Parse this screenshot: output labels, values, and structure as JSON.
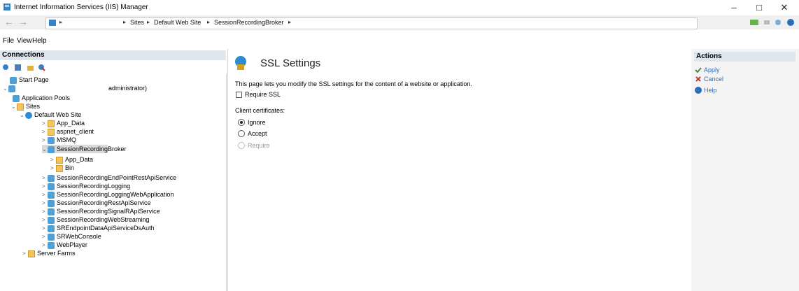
{
  "window": {
    "title": "Internet Information Services (IIS) Manager",
    "minimize": "–",
    "maximize": "□",
    "close": "✕"
  },
  "address": {
    "crumbs": [
      "Sites",
      "Default Web Site",
      "SessionRecordingBroker"
    ],
    "separator": "▸"
  },
  "menu": [
    "File",
    "View",
    "Help"
  ],
  "connections": {
    "header": "Connections",
    "tree": [
      {
        "label": "Start Page",
        "icon": "start-page-icon"
      },
      {
        "label": "administrator)",
        "icon": "server-icon",
        "expander": "⌄"
      },
      {
        "label": "Application Pools",
        "icon": "app-pools-icon"
      },
      {
        "label": "Sites",
        "icon": "sites-icon",
        "expander": "⌄"
      },
      {
        "label": "Default Web Site",
        "icon": "globe-icon",
        "expander": "⌄"
      },
      {
        "label": "App_Data",
        "icon": "folder-icon",
        "expander": ">"
      },
      {
        "label": "aspnet_client",
        "icon": "folder-icon",
        "expander": ">"
      },
      {
        "label": "MSMQ",
        "icon": "app-icon",
        "expander": ">"
      },
      {
        "label": "SessionRecordingBroker",
        "icon": "app-icon",
        "expander": "⌄",
        "selected": true
      },
      {
        "label": "App_Data",
        "icon": "folder-icon",
        "expander": ">"
      },
      {
        "label": "Bin",
        "icon": "folder-icon",
        "expander": ">"
      },
      {
        "label": "SessionRecordingEndPointRestApiService",
        "icon": "app-icon",
        "expander": ">"
      },
      {
        "label": "SessionRecordingLogging",
        "icon": "app-icon",
        "expander": ">"
      },
      {
        "label": "SessionRecordingLoggingWebApplication",
        "icon": "app-icon",
        "expander": ">"
      },
      {
        "label": "SessionRecordingRestApiService",
        "icon": "app-icon",
        "expander": ">"
      },
      {
        "label": "SessionRecordingSignalRApiService",
        "icon": "app-icon",
        "expander": ">"
      },
      {
        "label": "SessionRecordingWebStreaming",
        "icon": "app-icon",
        "expander": ">"
      },
      {
        "label": "SREndpointDataApiServiceDsAuth",
        "icon": "app-icon",
        "expander": ">"
      },
      {
        "label": "SRWebConsole",
        "icon": "app-icon",
        "expander": ">"
      },
      {
        "label": "WebPlayer",
        "icon": "app-icon",
        "expander": ">"
      },
      {
        "label": "Server Farms",
        "icon": "server-farms-icon",
        "expander": ">"
      }
    ]
  },
  "main": {
    "title": "SSL Settings",
    "description": "This page lets you modify the SSL settings for the content of a website or application.",
    "require_ssl": "Require SSL",
    "client_certificates": "Client certificates:",
    "options": [
      {
        "label": "Ignore",
        "checked": true,
        "disabled": false
      },
      {
        "label": "Accept",
        "checked": false,
        "disabled": false
      },
      {
        "label": "Require",
        "checked": false,
        "disabled": true
      }
    ]
  },
  "actions": {
    "header": "Actions",
    "items": [
      {
        "label": "Apply",
        "icon": "apply-icon"
      },
      {
        "label": "Cancel",
        "icon": "cancel-icon"
      },
      {
        "label": "Help",
        "icon": "help-icon"
      }
    ]
  },
  "colors": {
    "accent": "#2a6ebb",
    "header_bg": "#dfe6ee",
    "selected_row": "#d9d9d9"
  }
}
